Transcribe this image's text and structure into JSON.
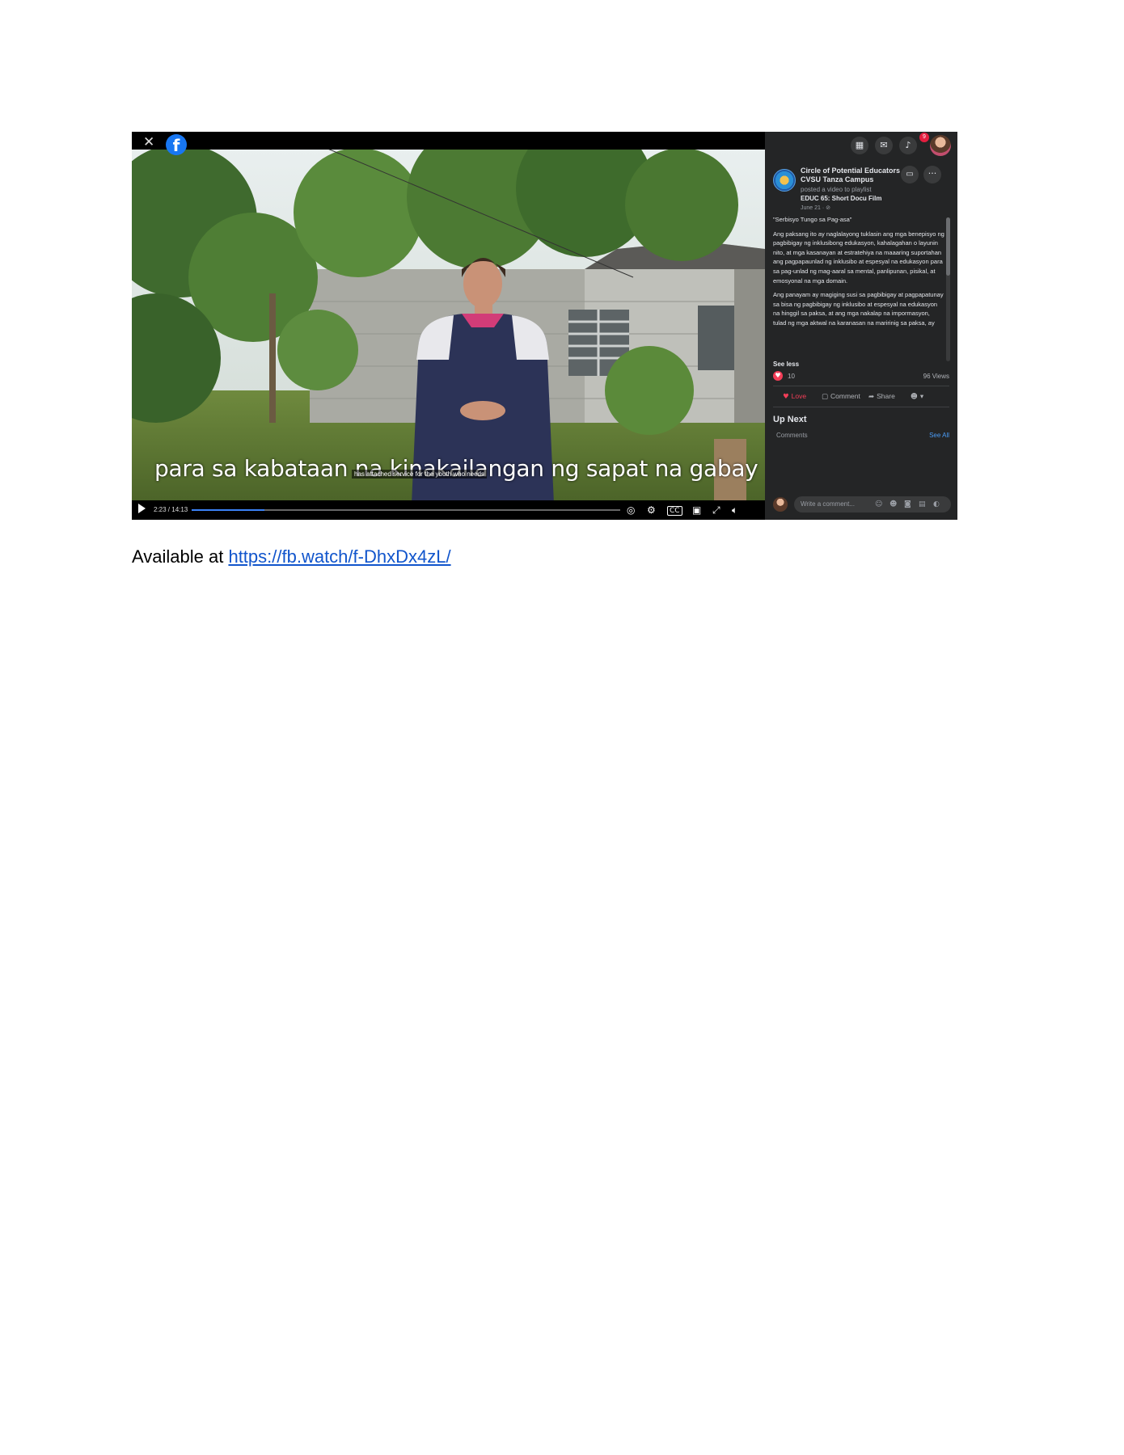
{
  "video": {
    "subtitle": "para sa kabataan na kinakailangan ng sapat na gabay",
    "translation": "has attached service for the youth who needs",
    "time": "2:23 / 14:13",
    "progress": 0.17
  },
  "panel": {
    "notification_count": "9",
    "page_name": "Circle of Potential Educators -CVSU Tanza Campus",
    "posted_text": "posted a video to playlist",
    "playlist": "EDUC 65: Short Docu Film",
    "date": "June 21 · ⊘",
    "description": [
      "\"Serbisyo Tungo sa Pag-asa\"",
      "Ang paksang ito ay naglalayong tuklasin ang mga benepisyo ng pagbibigay ng inklusibong edukasyon, kahalagahan o layunin nito, at mga kasanayan at estratehiya na maaaring suportahan ang pagpapaunlad ng inklusibo at espesyal na edukasyon para sa pag-unlad ng mag-aaral sa mental, panlipunan, pisikal, at emosyonal na mga domain.",
      "Ang panayam ay magiging susi sa pagbibigay at pagpapatunay sa bisa ng pagbibigay ng inklusibo at espesyal na edukasyon na hinggil sa paksa, at ang mga nakalap na impormasyon, tulad ng mga aktwal na karanasan na maririnig sa paksa, ay"
    ],
    "see_less": "See less",
    "reaction_count": "10",
    "views": "96 Views",
    "actions": {
      "love": "Love",
      "comment": "Comment",
      "share": "Share"
    },
    "up_next": "Up Next",
    "comments_label": "Comments",
    "see_all": "See All",
    "comment_placeholder": "Write a comment..."
  },
  "caption": {
    "prefix": "Available at ",
    "link": "https://fb.watch/f-DhxDx4zL/"
  }
}
